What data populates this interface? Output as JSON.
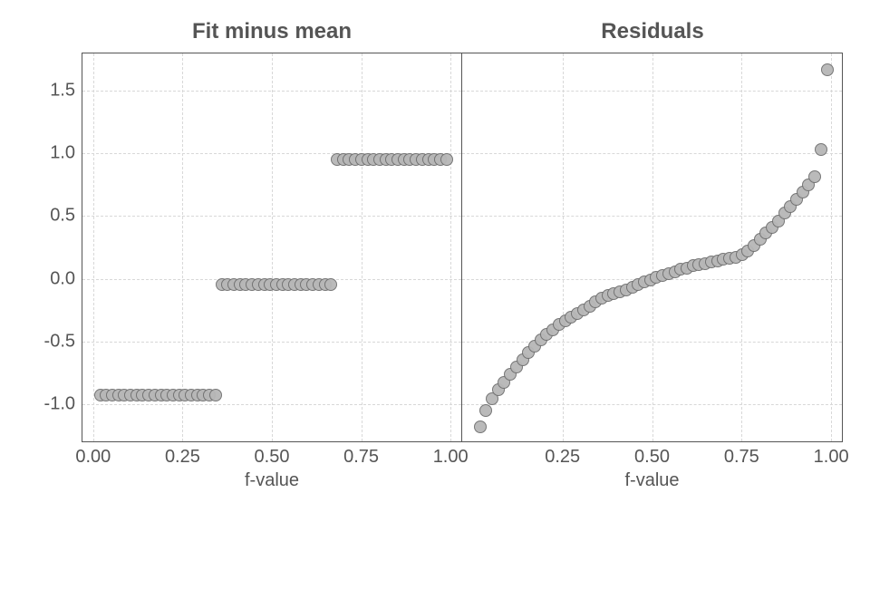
{
  "chart_data": [
    {
      "type": "scatter",
      "title": "Fit minus mean",
      "xlabel": "f-value",
      "ylabel": "",
      "xlim": [
        -0.03,
        1.03
      ],
      "ylim": [
        -1.3,
        1.8
      ],
      "xticks": [
        0.0,
        0.25,
        0.5,
        0.75,
        1.0
      ],
      "yticks": [
        -1.0,
        -0.5,
        0.0,
        0.5,
        1.0,
        1.5
      ],
      "series": [
        {
          "name": "fit_minus_mean",
          "x": [
            0.017,
            0.034,
            0.051,
            0.068,
            0.085,
            0.102,
            0.119,
            0.136,
            0.153,
            0.17,
            0.187,
            0.204,
            0.221,
            0.238,
            0.255,
            0.272,
            0.289,
            0.306,
            0.323,
            0.34,
            0.357,
            0.374,
            0.391,
            0.408,
            0.425,
            0.442,
            0.459,
            0.476,
            0.493,
            0.51,
            0.527,
            0.544,
            0.561,
            0.578,
            0.595,
            0.612,
            0.629,
            0.646,
            0.663,
            0.68,
            0.697,
            0.714,
            0.731,
            0.748,
            0.765,
            0.782,
            0.799,
            0.816,
            0.833,
            0.85,
            0.867,
            0.884,
            0.901,
            0.918,
            0.935,
            0.952,
            0.969,
            0.986
          ],
          "y": [
            -0.92,
            -0.92,
            -0.92,
            -0.92,
            -0.92,
            -0.92,
            -0.92,
            -0.92,
            -0.92,
            -0.92,
            -0.92,
            -0.92,
            -0.92,
            -0.92,
            -0.92,
            -0.92,
            -0.92,
            -0.92,
            -0.92,
            -0.92,
            -0.04,
            -0.04,
            -0.04,
            -0.04,
            -0.04,
            -0.04,
            -0.04,
            -0.04,
            -0.04,
            -0.04,
            -0.04,
            -0.04,
            -0.04,
            -0.04,
            -0.04,
            -0.04,
            -0.04,
            -0.04,
            -0.04,
            0.96,
            0.96,
            0.96,
            0.96,
            0.96,
            0.96,
            0.96,
            0.96,
            0.96,
            0.96,
            0.96,
            0.96,
            0.96,
            0.96,
            0.96,
            0.96,
            0.96,
            0.96,
            0.96
          ]
        }
      ]
    },
    {
      "type": "scatter",
      "title": "Residuals",
      "xlabel": "f-value",
      "ylabel": "",
      "xlim": [
        -0.03,
        1.03
      ],
      "ylim": [
        -1.3,
        1.8
      ],
      "xticks": [
        0.25,
        0.5,
        0.75,
        1.0
      ],
      "yticks": [
        -1.0,
        -0.5,
        0.0,
        0.5,
        1.0,
        1.5
      ],
      "series": [
        {
          "name": "residuals",
          "x": [
            0.017,
            0.034,
            0.051,
            0.068,
            0.085,
            0.102,
            0.119,
            0.136,
            0.153,
            0.17,
            0.187,
            0.204,
            0.221,
            0.238,
            0.255,
            0.272,
            0.289,
            0.306,
            0.323,
            0.34,
            0.357,
            0.374,
            0.391,
            0.408,
            0.425,
            0.442,
            0.459,
            0.476,
            0.493,
            0.51,
            0.527,
            0.544,
            0.561,
            0.578,
            0.595,
            0.612,
            0.629,
            0.646,
            0.663,
            0.68,
            0.697,
            0.714,
            0.731,
            0.748,
            0.765,
            0.782,
            0.799,
            0.816,
            0.833,
            0.85,
            0.867,
            0.884,
            0.901,
            0.918,
            0.935,
            0.952,
            0.969,
            0.986
          ],
          "y": [
            -1.18,
            -1.05,
            -0.95,
            -0.88,
            -0.82,
            -0.76,
            -0.7,
            -0.64,
            -0.58,
            -0.53,
            -0.48,
            -0.44,
            -0.4,
            -0.36,
            -0.33,
            -0.3,
            -0.27,
            -0.24,
            -0.21,
            -0.18,
            -0.15,
            -0.13,
            -0.11,
            -0.1,
            -0.08,
            -0.06,
            -0.04,
            -0.02,
            0.0,
            0.02,
            0.03,
            0.05,
            0.06,
            0.08,
            0.09,
            0.11,
            0.12,
            0.13,
            0.14,
            0.15,
            0.16,
            0.17,
            0.18,
            0.2,
            0.23,
            0.27,
            0.32,
            0.37,
            0.42,
            0.47,
            0.53,
            0.58,
            0.64,
            0.7,
            0.76,
            0.82,
            1.04,
            1.68
          ]
        }
      ]
    }
  ],
  "xtick_labels_left": [
    "0.00",
    "0.25",
    "0.50",
    "0.75",
    "1.00"
  ],
  "xtick_labels_right": [
    "0.25",
    "0.50",
    "0.75",
    "1.00"
  ],
  "ytick_labels": [
    "-1.0",
    "-0.5",
    "0.0",
    "0.5",
    "1.0",
    "1.5"
  ]
}
